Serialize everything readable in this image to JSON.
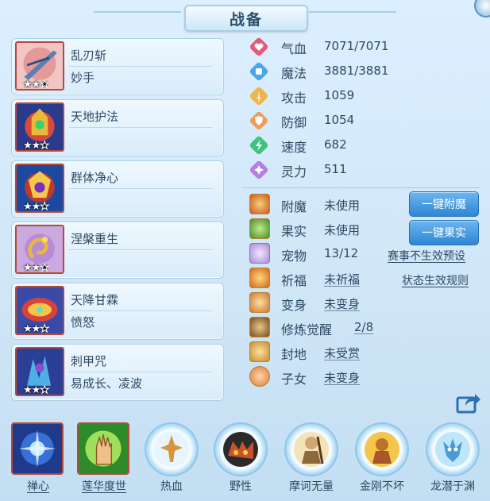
{
  "window": {
    "title": "战备"
  },
  "skills": [
    {
      "name": "乱刃斩",
      "sub": "妙手",
      "stars_on": 2,
      "stars_off": 1
    },
    {
      "name": "天地护法",
      "sub": "",
      "stars_on": 2,
      "stars_off": 1
    },
    {
      "name": "群体净心",
      "sub": "",
      "stars_on": 2,
      "stars_off": 1
    },
    {
      "name": "涅槃重生",
      "sub": "",
      "stars_on": 2,
      "stars_off": 1
    },
    {
      "name": "天降甘霖",
      "sub": "愤怒",
      "stars_on": 2,
      "stars_off": 1
    },
    {
      "name": "刺甲咒",
      "sub": "易成长、凌波",
      "stars_on": 2,
      "stars_off": 1
    }
  ],
  "stats": [
    {
      "label": "气血",
      "value": "7071/7071",
      "icon": "heart-gem-icon",
      "color": "#e35a7a"
    },
    {
      "label": "魔法",
      "value": "3881/3881",
      "icon": "mana-gem-icon",
      "color": "#4aa6ec"
    },
    {
      "label": "攻击",
      "value": "1059",
      "icon": "sword-gem-icon",
      "color": "#f3b34a"
    },
    {
      "label": "防御",
      "value": "1054",
      "icon": "shield-gem-icon",
      "color": "#f09d5a"
    },
    {
      "label": "速度",
      "value": "682",
      "icon": "speed-gem-icon",
      "color": "#3fc37f"
    },
    {
      "label": "灵力",
      "value": "511",
      "icon": "spirit-gem-icon",
      "color": "#b67de4"
    }
  ],
  "attributes": [
    {
      "label": "附魔",
      "value": "未使用"
    },
    {
      "label": "果实",
      "value": "未使用"
    },
    {
      "label": "宠物",
      "value": "13/12"
    },
    {
      "label": "祈福",
      "value": "未祈福"
    },
    {
      "label": "变身",
      "value": "未变身"
    },
    {
      "label": "修炼觉醒",
      "value": "2/8"
    },
    {
      "label": "封地",
      "value": "未受赏"
    },
    {
      "label": "子女",
      "value": "未变身"
    }
  ],
  "buttons": {
    "enchant": "一键附魔",
    "fruit": "一键果实"
  },
  "links": {
    "preset": "赛事不生效预设",
    "rules": "状态生效规则"
  },
  "bottom_skills": [
    {
      "label": "禅心"
    },
    {
      "label": "莲华度世"
    },
    {
      "label": "热血"
    },
    {
      "label": "野性"
    },
    {
      "label": "摩诃无量"
    },
    {
      "label": "金刚不坏"
    },
    {
      "label": "龙潜于渊"
    }
  ],
  "colors": {
    "accent": "#2f86d4",
    "text": "#2d4963",
    "panel": "#d9ecfa"
  }
}
